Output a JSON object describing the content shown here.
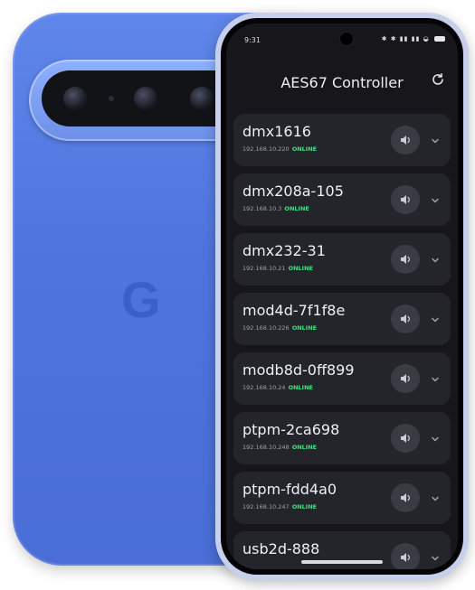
{
  "status_bar": {
    "time": "9:31",
    "icons": "✱ ✱ ▮▮ ▮▮ ◒"
  },
  "app": {
    "title": "AES67 Controller",
    "refresh_icon": "refresh-icon"
  },
  "devices": [
    {
      "name": "dmx1616",
      "ip": "192.168.10.220",
      "status": "ONLINE"
    },
    {
      "name": "dmx208a-105",
      "ip": "192.168.10.3",
      "status": "ONLINE"
    },
    {
      "name": "dmx232-31",
      "ip": "192.168.10.21",
      "status": "ONLINE"
    },
    {
      "name": "mod4d-7f1f8e",
      "ip": "192.168.10.226",
      "status": "ONLINE"
    },
    {
      "name": "modb8d-0ff899",
      "ip": "192.168.10.24",
      "status": "ONLINE"
    },
    {
      "name": "ptpm-2ca698",
      "ip": "192.168.10.248",
      "status": "ONLINE"
    },
    {
      "name": "ptpm-fdd4a0",
      "ip": "192.168.10.247",
      "status": "ONLINE"
    },
    {
      "name": "usb2d-888",
      "ip": "",
      "status": ""
    }
  ],
  "brand": {
    "back_logo": "G"
  },
  "colors": {
    "phone_blue": "#5b80e6",
    "screen_bg": "#17171b",
    "card_bg": "#24252b",
    "online_green": "#4ade80"
  }
}
